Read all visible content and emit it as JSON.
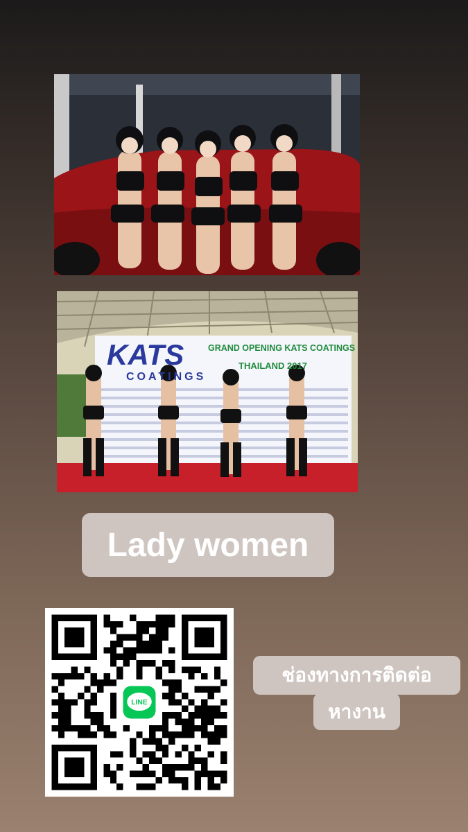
{
  "story": {
    "photo1": {
      "alt": "promotion models posing on red car"
    },
    "photo2": {
      "alt": "models performing on stage",
      "banner_brand": "KATS",
      "banner_brand_sub": "COATINGS",
      "banner_line1": "GRAND OPENING KATS COATINGS",
      "banner_line2": "THAILAND 2017"
    },
    "title": "Lady women",
    "contact_line1": "ช่องทางการติดต่อ",
    "contact_line2": "หางาน",
    "qr": {
      "center_badge": "LINE"
    }
  },
  "colors": {
    "pill": "#cfc5c0",
    "line_green": "#06c755",
    "banner_blue": "#2a3a9c",
    "banner_green": "#1f8a3c"
  }
}
